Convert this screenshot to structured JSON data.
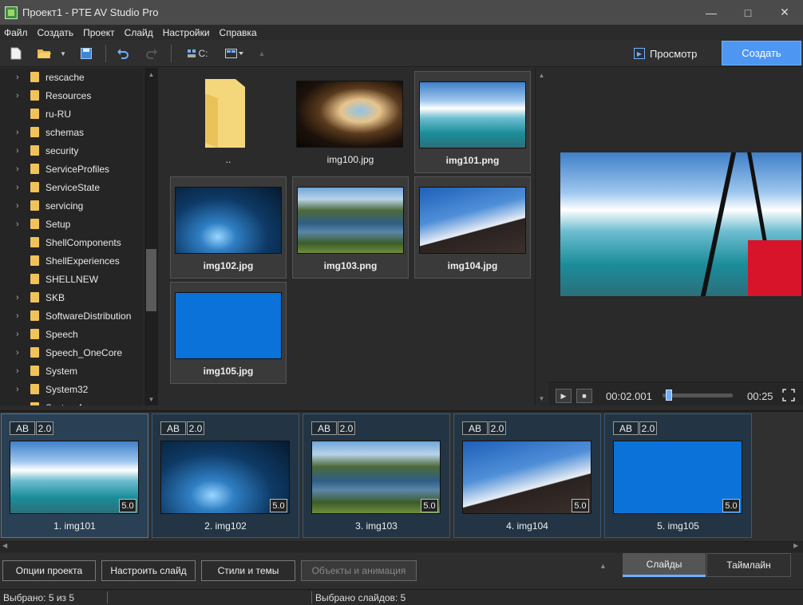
{
  "window": {
    "title": "Проект1 - PTE AV Studio Pro",
    "min": "—",
    "max": "□",
    "close": "✕"
  },
  "menu": [
    "Файл",
    "Создать",
    "Проект",
    "Слайд",
    "Настройки",
    "Справка"
  ],
  "toolbar": {
    "drive_label": "C:",
    "preview_label": "Просмотр",
    "create_label": "Создать"
  },
  "tree": [
    {
      "label": "rescache",
      "expandable": true
    },
    {
      "label": "Resources",
      "expandable": true
    },
    {
      "label": "ru-RU",
      "expandable": false
    },
    {
      "label": "schemas",
      "expandable": true
    },
    {
      "label": "security",
      "expandable": true
    },
    {
      "label": "ServiceProfiles",
      "expandable": true
    },
    {
      "label": "ServiceState",
      "expandable": true
    },
    {
      "label": "servicing",
      "expandable": true
    },
    {
      "label": "Setup",
      "expandable": true
    },
    {
      "label": "ShellComponents",
      "expandable": false
    },
    {
      "label": "ShellExperiences",
      "expandable": false
    },
    {
      "label": "SHELLNEW",
      "expandable": false
    },
    {
      "label": "SKB",
      "expandable": true
    },
    {
      "label": "SoftwareDistribution",
      "expandable": true
    },
    {
      "label": "Speech",
      "expandable": true
    },
    {
      "label": "Speech_OneCore",
      "expandable": true
    },
    {
      "label": "System",
      "expandable": true
    },
    {
      "label": "System32",
      "expandable": true
    },
    {
      "label": "SystemApps",
      "expandable": true
    }
  ],
  "files": [
    {
      "name": "..",
      "type": "folder",
      "selected": false
    },
    {
      "name": "img100.jpg",
      "type": "cave",
      "selected": false
    },
    {
      "name": "img101.png",
      "type": "sky",
      "selected": true
    },
    {
      "name": "img102.jpg",
      "type": "ice",
      "selected": true
    },
    {
      "name": "img103.png",
      "type": "lake",
      "selected": true
    },
    {
      "name": "img104.jpg",
      "type": "hill",
      "selected": true
    },
    {
      "name": "img105.jpg",
      "type": "blue",
      "selected": true
    }
  ],
  "player": {
    "current_time": "00:02.001",
    "total_time": "00:25",
    "progress": 0.08
  },
  "slides": [
    {
      "name": "1. img101",
      "badge_ab": "AB",
      "badge_tr": "2.0",
      "duration": "5.0",
      "type": "sky"
    },
    {
      "name": "2. img102",
      "badge_ab": "AB",
      "badge_tr": "2.0",
      "duration": "5.0",
      "type": "ice"
    },
    {
      "name": "3. img103",
      "badge_ab": "AB",
      "badge_tr": "2.0",
      "duration": "5.0",
      "type": "lake"
    },
    {
      "name": "4. img104",
      "badge_ab": "AB",
      "badge_tr": "2.0",
      "duration": "5.0",
      "type": "hill"
    },
    {
      "name": "5. img105",
      "badge_ab": "AB",
      "badge_tr": "2.0",
      "duration": "5.0",
      "type": "blue"
    }
  ],
  "bottom": {
    "project_options": "Опции проекта",
    "customize_slide": "Настроить слайд",
    "styles_themes": "Стили и темы",
    "objects_animation": "Объекты и анимация",
    "tab_slides": "Слайды",
    "tab_timeline": "Таймлайн"
  },
  "status": {
    "selected": "Выбрано: 5 из 5",
    "selected_slides": "Выбрано слайдов: 5"
  },
  "colors": {
    "accent": "#4d97f3",
    "folder": "#f0c35a"
  }
}
